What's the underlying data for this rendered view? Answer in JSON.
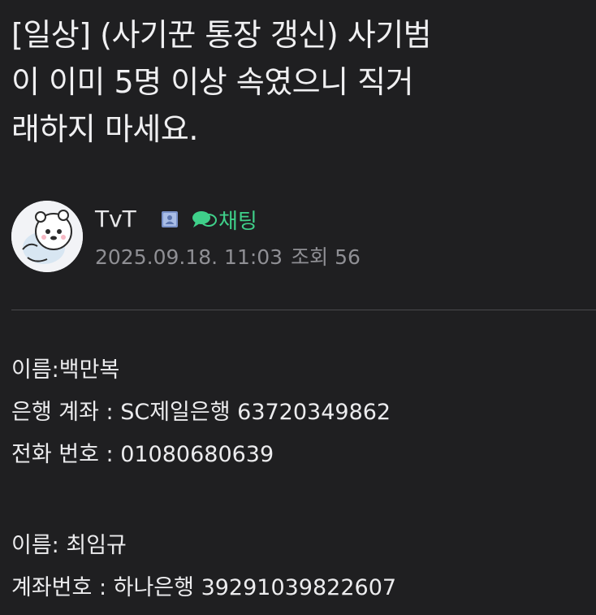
{
  "post": {
    "title_lines": [
      "[일상] (사기꾼 통장 갱신) 사기범",
      "이 이미 5명 이상 속였으니 직거",
      "래하지 마세요."
    ]
  },
  "author": {
    "name": "TvT",
    "level_icon": "member-level-icon",
    "chat_label": "채팅",
    "chat_icon": "chat-bubble-icon",
    "chat_color": "#3fd08a",
    "date": "2025.09.18. 11:03",
    "views_label": "조회",
    "views_count": "56"
  },
  "content": {
    "block1": [
      "이름:백만복",
      "은행 계좌 : SC제일은행 63720349862",
      "전화 번호 : 01080680639"
    ],
    "block2": [
      "이름: 최임규",
      "계좌번호 : 하나은행 39291039822607"
    ]
  },
  "colors": {
    "background": "#1f1f21",
    "text": "#e8e8ea",
    "muted": "#8f8f94",
    "divider": "#4a4a4e"
  }
}
